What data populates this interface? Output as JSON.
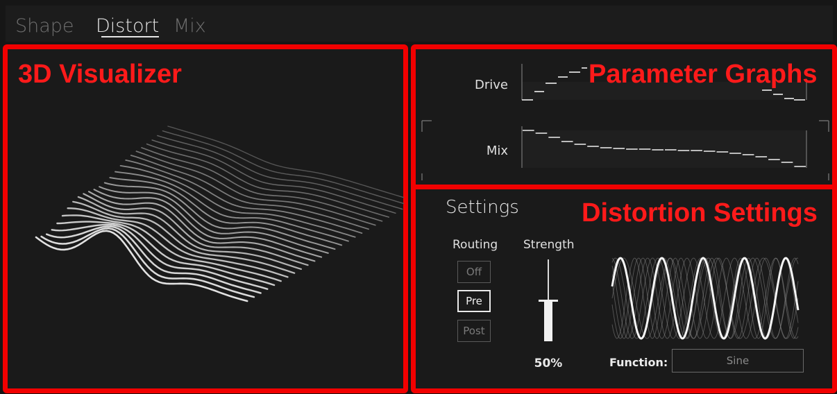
{
  "tabs": [
    {
      "label": "Shape",
      "active": false
    },
    {
      "label": "Distort",
      "active": true
    },
    {
      "label": "Mix",
      "active": false
    }
  ],
  "overlays": {
    "visualizer": "3D Visualizer",
    "graphs": "Parameter Graphs",
    "distortion": "Distortion Settings"
  },
  "graphs": {
    "drive_label": "Drive",
    "mix_label": "Mix"
  },
  "settings": {
    "title": "Settings",
    "routing_label": "Routing",
    "strength_label": "Strength",
    "routing_options": [
      "Off",
      "Pre",
      "Post"
    ],
    "routing_selected": "Pre",
    "strength_value": "50%",
    "strength_fraction": 0.5,
    "function_label": "Function:",
    "function_value": "Sine"
  },
  "colors": {
    "background": "#161616",
    "highlight": "#f20000",
    "text": "#e6e6e6",
    "dim": "#6f6f6f"
  }
}
